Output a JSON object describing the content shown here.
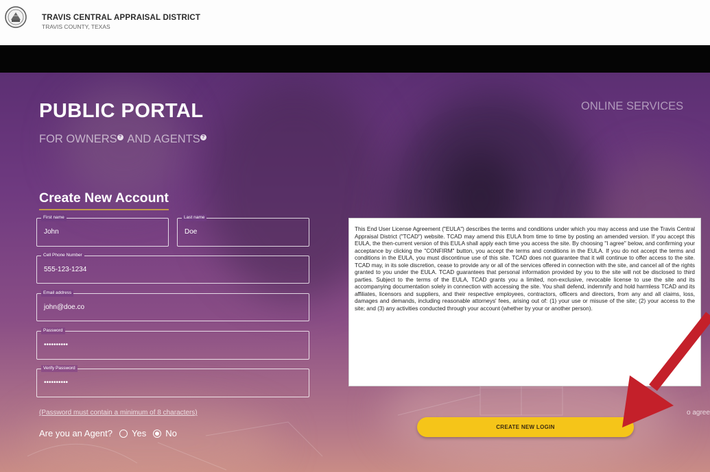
{
  "header": {
    "org_name": "TRAVIS CENTRAL APPRAISAL DISTRICT",
    "org_sub": "TRAVIS COUNTY, TEXAS",
    "seal_icon": "county-seal-icon"
  },
  "hero": {
    "title": "PUBLIC PORTAL",
    "subtitle_part1": "FOR OWNERS",
    "subtitle_part2": " AND AGENTS",
    "help_glyph": "?",
    "online_services": "ONLINE SERVICES"
  },
  "form": {
    "heading": "Create New Account",
    "first_name": {
      "label": "First name",
      "value": "John"
    },
    "last_name": {
      "label": "Last name",
      "value": "Doe"
    },
    "phone": {
      "label": "Cell Phone Number",
      "value": "555-123-1234"
    },
    "email": {
      "label": "Email address",
      "value": "john@doe.co"
    },
    "password": {
      "label": "Password",
      "value": "••••••••••"
    },
    "verify_password": {
      "label": "Verify Password",
      "value": "••••••••••"
    },
    "password_note": "(Password must contain a minimum of 8 characters)",
    "agent_question": "Are you an Agent?",
    "agent_yes": "Yes",
    "agent_no": "No",
    "agent_selected": "No"
  },
  "eula": {
    "text": "This End User License Agreement (\"EULA\") describes the terms and conditions under which you may access and use the Travis Central Appraisal District (\"TCAD\") website. TCAD may amend this EULA from time to time by posting an amended version. If you accept this EULA, the then-current version of this EULA shall apply each time you access the site. By choosing \"I agree\" below, and confirming your acceptance by clicking the \"CONFIRM\" button, you accept the terms and conditions in the EULA. If you do not accept the terms and conditions in the EULA, you must discontinue use of this site. TCAD does not guarantee that it will continue to offer access to the site. TCAD may, in its sole discretion, cease to provide any or all of the services offered in connection with the site, and cancel all of the rights granted to you under the EULA. TCAD guarantees that personal information provided by you to the site will not be disclosed to third parties. Subject to the terms of the EULA, TCAD grants you a limited, non-exclusive, revocable license to use the site and its accompanying documentation solely in connection with accessing the site. You shall defend, indemnify and hold harmless TCAD and its affiliates, licensors and suppliers, and their respective employees, contractors, officers and directors, from any and all claims, loss, damages and demands, including reasonable attorneys' fees, arising out of: (1) your use or misuse of the site; (2) your access to the site; and (3) any activities conducted through your account (whether by your or another person).",
    "agree_fragment": "o agree"
  },
  "actions": {
    "create_login": "CREATE NEW LOGIN"
  },
  "annotation": {
    "arrow_color": "#c4202a"
  },
  "colors": {
    "hero_top": "#5c2f73",
    "hero_bottom": "#c98c86",
    "button": "#f5c519",
    "heading_underline": "#c49a4a"
  }
}
